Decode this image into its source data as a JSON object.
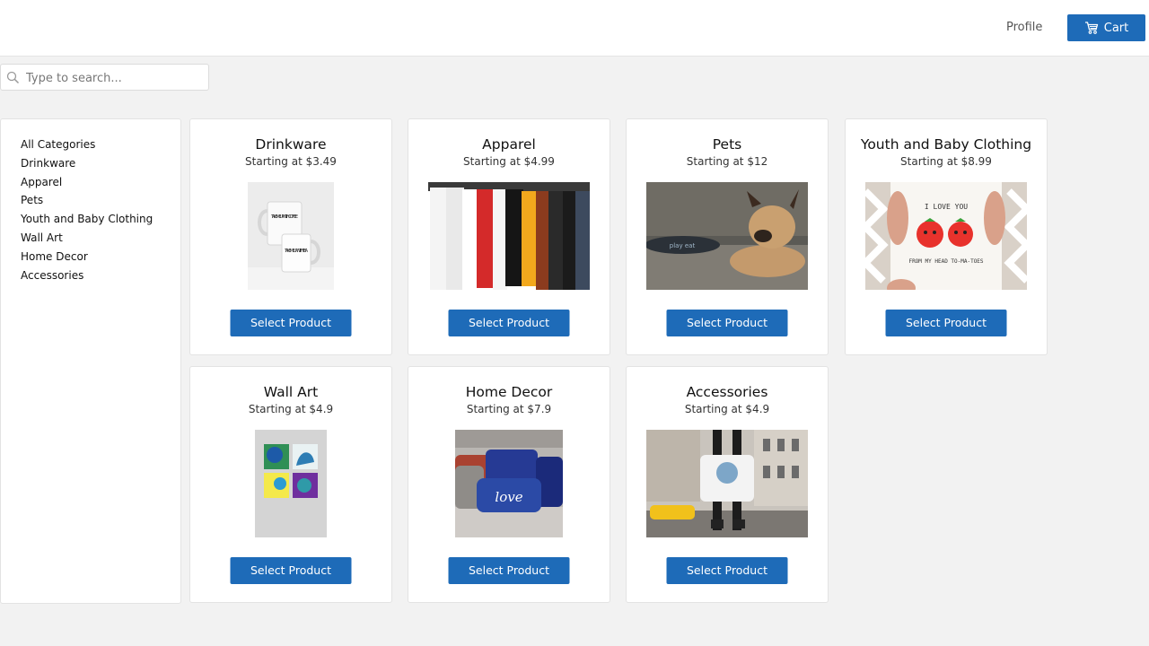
{
  "header": {
    "profile_label": "Profile",
    "cart_label": "Cart",
    "accent_color": "#1e6bb8"
  },
  "search": {
    "placeholder": "Type to search...",
    "value": ""
  },
  "sidebar": {
    "items": [
      {
        "label": "All Categories"
      },
      {
        "label": "Drinkware"
      },
      {
        "label": "Apparel"
      },
      {
        "label": "Pets"
      },
      {
        "label": "Youth and Baby Clothing"
      },
      {
        "label": "Wall Art"
      },
      {
        "label": "Home Decor"
      },
      {
        "label": "Accessories"
      }
    ]
  },
  "products": [
    {
      "title": "Drinkware",
      "price": "Starting at $3.49",
      "button": "Select Product",
      "image": "mugs-photo"
    },
    {
      "title": "Apparel",
      "price": "Starting at $4.99",
      "button": "Select Product",
      "image": "tshirts-rack-photo"
    },
    {
      "title": "Pets",
      "price": "Starting at $12",
      "button": "Select Product",
      "image": "bulldog-bowl-photo"
    },
    {
      "title": "Youth and Baby Clothing",
      "price": "Starting at $8.99",
      "button": "Select Product",
      "image": "baby-onesie-photo"
    },
    {
      "title": "Wall Art",
      "price": "Starting at $4.9",
      "button": "Select Product",
      "image": "canvas-prints-photo"
    },
    {
      "title": "Home Decor",
      "price": "Starting at $7.9",
      "button": "Select Product",
      "image": "pillows-photo"
    },
    {
      "title": "Accessories",
      "price": "Starting at $4.9",
      "button": "Select Product",
      "image": "tote-bag-photo"
    }
  ],
  "image_text": {
    "mug_front": "TAKE ME UP WITH COFFEE",
    "mug_back": "TAKE ME UP WITH TEA",
    "pet_bowl": "play eat",
    "onesie_top": "I LOVE YOU",
    "onesie_bottom": "FROM MY HEAD TO-MA-TOES",
    "pillow": "love"
  }
}
